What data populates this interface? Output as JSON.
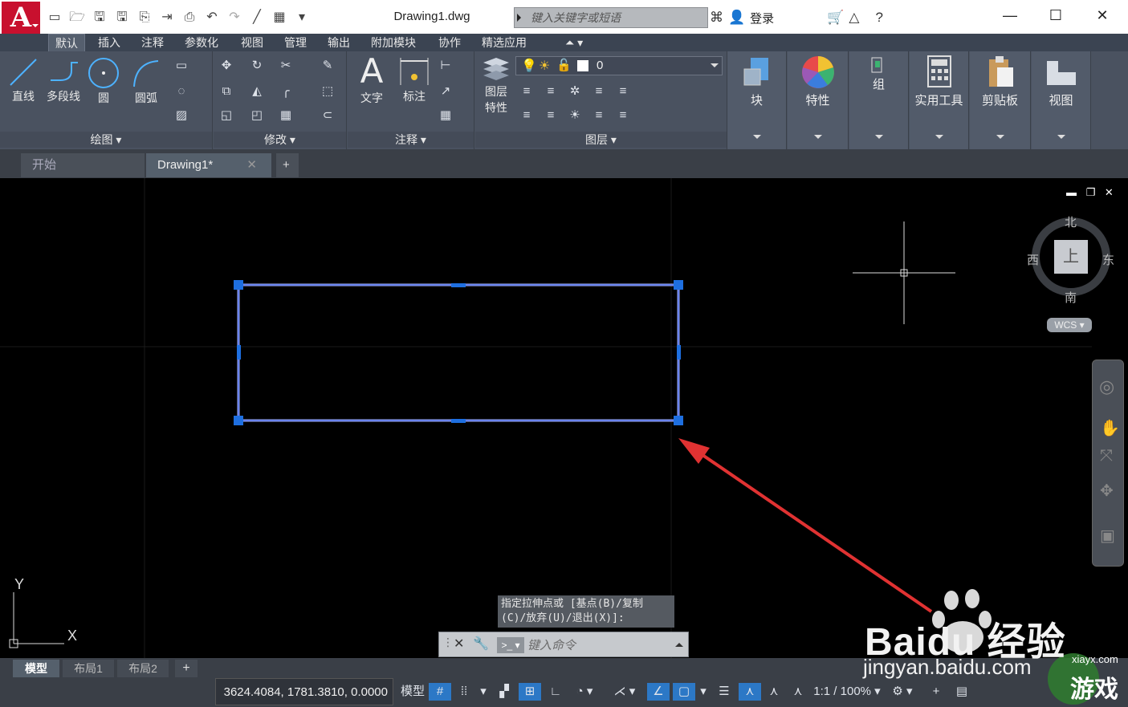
{
  "app": {
    "logo_letter": "A",
    "document_title": "Drawing1.dwg",
    "search_placeholder": "键入关键字或短语",
    "login_label": "登录"
  },
  "ribbon_tabs": [
    "默认",
    "插入",
    "注释",
    "参数化",
    "视图",
    "管理",
    "输出",
    "附加模块",
    "协作",
    "精选应用"
  ],
  "ribbon": {
    "draw": {
      "title": "绘图",
      "tools": [
        "直线",
        "多段线",
        "圆",
        "圆弧"
      ]
    },
    "modify": {
      "title": "修改"
    },
    "annotation": {
      "title": "注释",
      "tools": [
        "文字",
        "标注"
      ]
    },
    "layers": {
      "title": "图层",
      "layer_properties_line1": "图层",
      "layer_properties_line2": "特性",
      "current_layer": "0"
    },
    "big_tools": [
      "块",
      "特性",
      "组",
      "实用工具",
      "剪贴板",
      "视图"
    ]
  },
  "doc_tabs": {
    "start": "开始",
    "drawing": "Drawing1*",
    "add": "+"
  },
  "viewcube": {
    "north": "北",
    "south": "南",
    "east": "东",
    "west": "西",
    "top_face": "上",
    "wcs": "WCS"
  },
  "ucs": {
    "x_label": "X",
    "y_label": "Y"
  },
  "command": {
    "history_line1": "指定拉伸点或 [基点(B)/复制",
    "history_line2": "(C)/放弃(U)/退出(X)]:",
    "input_placeholder": "键入命令"
  },
  "layout_tabs": [
    "模型",
    "布局1",
    "布局2"
  ],
  "status": {
    "coordinates": "3624.4084, 1781.3810, 0.0000",
    "model_label": "模型",
    "scale": "1:1 / 100%"
  },
  "watermark": {
    "brand": "Baidu 经验",
    "url": "jingyan.baidu.com",
    "site": "xiayx.com",
    "game": "游戏"
  },
  "colors": {
    "accent": "#2c78c6",
    "selection": "#1e6fe0",
    "arrow": "#e03232",
    "ribbon_bg": "#4a5260"
  }
}
